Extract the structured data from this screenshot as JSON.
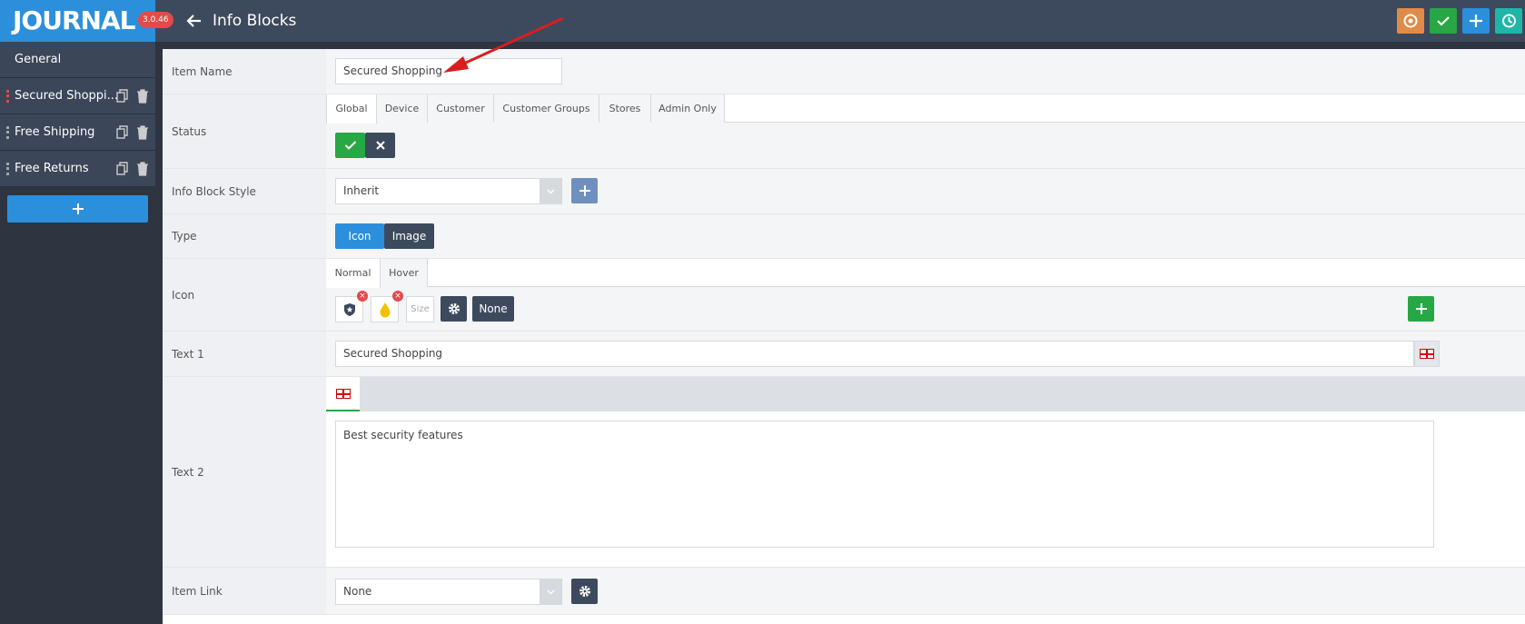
{
  "app": {
    "logo": "JOURNAL",
    "version": "3.0.46",
    "page_title": "Info Blocks"
  },
  "sidebar": {
    "general_label": "General",
    "items": [
      {
        "label": "Secured Shoppi..."
      },
      {
        "label": "Free Shipping"
      },
      {
        "label": "Free Returns"
      }
    ],
    "add_label": "+"
  },
  "toolbar": {
    "colors": {
      "reset": "#e08b4a",
      "save": "#28a745",
      "add": "#2b8fdc",
      "history": "#1fb5a8"
    }
  },
  "form": {
    "item_name": {
      "label": "Item Name",
      "value": "Secured Shopping"
    },
    "status": {
      "label": "Status",
      "tabs": [
        "Global",
        "Device",
        "Customer",
        "Customer Groups",
        "Stores",
        "Admin Only"
      ]
    },
    "style": {
      "label": "Info Block Style",
      "value": "Inherit"
    },
    "type": {
      "label": "Type",
      "options": [
        "Icon",
        "Image"
      ]
    },
    "icon": {
      "label": "Icon",
      "tabs": [
        "Normal",
        "Hover"
      ],
      "size_placeholder": "Size",
      "none_label": "None"
    },
    "text1": {
      "label": "Text 1",
      "value": "Secured Shopping"
    },
    "text2": {
      "label": "Text 2",
      "value": "Best security features"
    },
    "item_link": {
      "label": "Item Link",
      "value": "None"
    }
  }
}
